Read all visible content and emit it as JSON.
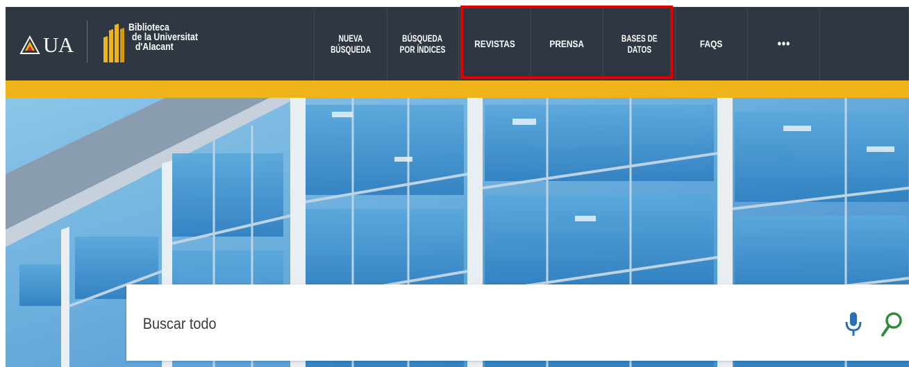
{
  "header": {
    "ua_logo_text": "UA",
    "library_name": [
      "Biblioteca",
      "de la Universitat",
      "d'Alacant"
    ],
    "nav": [
      {
        "lines": [
          "NUEVA",
          "BÚSQUEDA"
        ]
      },
      {
        "lines": [
          "BÚSQUEDA",
          "POR ÍNDICES"
        ]
      },
      {
        "lines": [
          "REVISTAS"
        ]
      },
      {
        "lines": [
          "PRENSA"
        ]
      },
      {
        "lines": [
          "BASES DE",
          "DATOS"
        ]
      },
      {
        "lines": [
          "FAQS"
        ]
      },
      {
        "lines": [
          "•••"
        ]
      }
    ]
  },
  "search": {
    "placeholder": "Buscar todo",
    "mic_icon": "microphone-icon",
    "search_icon": "magnifier-icon"
  },
  "colors": {
    "header_bg": "#2f3742",
    "accent_bar": "#efb417",
    "highlight_box": "#e10000",
    "mic": "#2a6fb3",
    "search_icon": "#2e8b3a"
  }
}
